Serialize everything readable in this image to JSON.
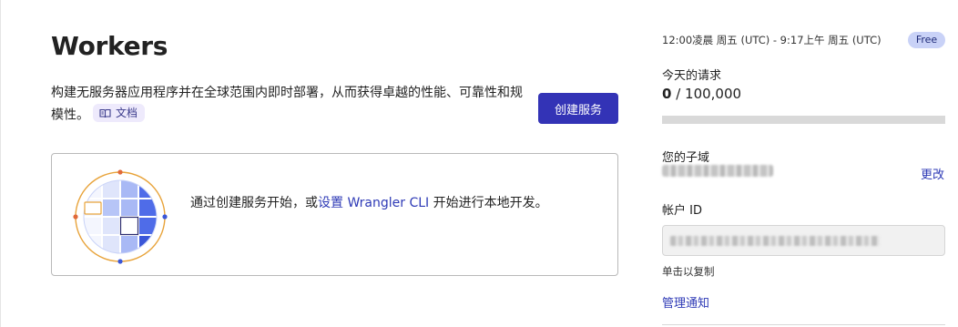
{
  "header": {
    "title": "Workers",
    "description": "构建无服务器应用程序并在全球范围内即时部署，从而获得卓越的性能、可靠性和规模性。",
    "docs_label": "文档",
    "docs_icon": "book-icon",
    "create_button": "创建服务"
  },
  "get_started": {
    "illustration": "globe-illustration",
    "text_before": "通过创建服务开始，或",
    "link_text": "设置 Wrangler CLI",
    "text_after": " 开始进行本地开发。"
  },
  "sidebar": {
    "time_range": "12:00凌晨 周五 (UTC) - 9:17上午 周五 (UTC)",
    "plan_badge": "Free",
    "requests_label": "今天的请求",
    "requests_used": "0",
    "requests_separator": " / ",
    "requests_limit": "100,000",
    "requests_fraction": 0,
    "subdomain_label": "您的子域",
    "change_link": "更改",
    "account_id_label": "帐户 ID",
    "copy_hint": "单击以复制",
    "manage_notifications": "管理通知"
  },
  "colors": {
    "accent": "#3333b6",
    "link": "#2e3ab6",
    "badge_bg": "#c9d2f7",
    "docs_chip_bg": "#eeeafc"
  }
}
